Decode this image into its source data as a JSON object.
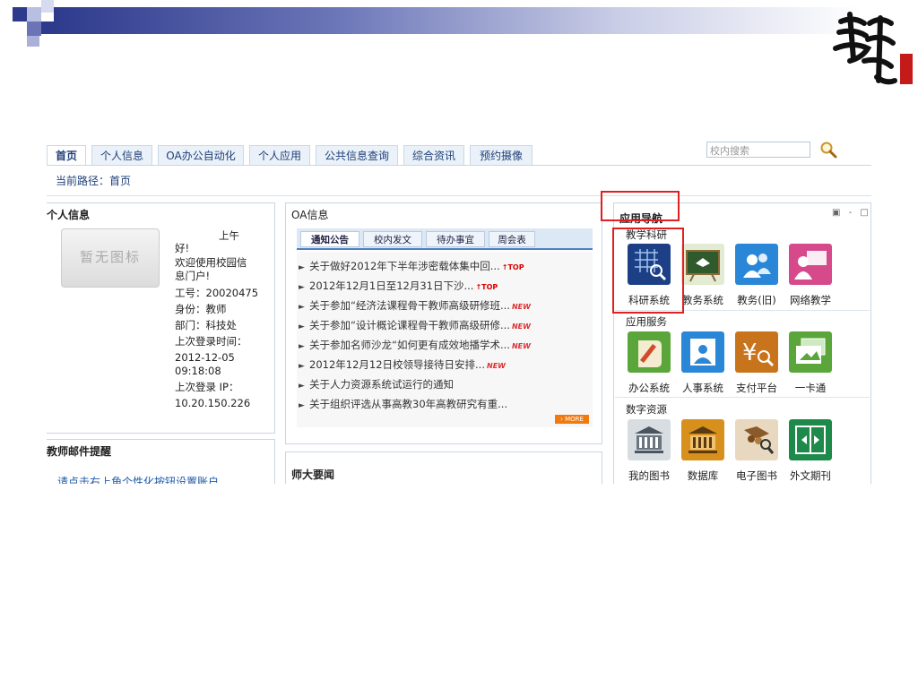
{
  "nav": {
    "tabs": [
      "首页",
      "个人信息",
      "OA办公自动化",
      "个人应用",
      "公共信息查询",
      "综合资讯",
      "预约摄像"
    ],
    "search_placeholder": "校内搜索"
  },
  "breadcrumb": "当前路径：首页",
  "personal": {
    "title": "个人信息",
    "avatar_text": "暂无图标",
    "lines": [
      "上午",
      "好!",
      "欢迎使用校园信",
      "息门户!",
      "工号：20020475",
      "身份：教师",
      "部门：科技处",
      "上次登录时间：",
      "2012-12-05",
      "09:18:08",
      "上次登录 IP：",
      "10.20.150.226"
    ]
  },
  "mail": {
    "title": "教师邮件提醒",
    "link": "请点击右上角个性化按钮设置账户"
  },
  "oa": {
    "title": "OA信息",
    "tabs": [
      "通知公告",
      "校内发文",
      "待办事宜",
      "周会表"
    ],
    "items": [
      {
        "text": "关于做好2012年下半年涉密载体集中回...",
        "badge": "TOP"
      },
      {
        "text": "2012年12月1日至12月31日下沙...",
        "badge": "TOP"
      },
      {
        "text": "关于参加“经济法课程骨干教师高级研修班...",
        "badge": "NEW"
      },
      {
        "text": "关于参加“设计概论课程骨干教师高级研修...",
        "badge": "NEW"
      },
      {
        "text": "关于参加名师沙龙“如何更有成效地播学术...",
        "badge": "NEW"
      },
      {
        "text": "2012年12月12日校领导接待日安排...",
        "badge": "NEW"
      },
      {
        "text": "关于人力资源系统试运行的通知",
        "badge": ""
      },
      {
        "text": "关于组织评选从事高教30年高教研究有重...",
        "badge": ""
      }
    ],
    "more": "› MORE"
  },
  "news": {
    "title": "师大要闻"
  },
  "appnav": {
    "title": "应用导航",
    "sections": [
      {
        "title": "教学科研",
        "apps": [
          {
            "label": "科研系统",
            "icon": "grid-magnifier-icon"
          },
          {
            "label": "教务系统",
            "icon": "blackboard-icon"
          },
          {
            "label": "教务(旧)",
            "icon": "users-icon"
          },
          {
            "label": "网络教学",
            "icon": "teacher-icon"
          }
        ]
      },
      {
        "title": "应用服务",
        "apps": [
          {
            "label": "办公系统",
            "icon": "scroll-icon"
          },
          {
            "label": "人事系统",
            "icon": "person-card-icon"
          },
          {
            "label": "支付平台",
            "icon": "yen-search-icon"
          },
          {
            "label": "一卡通",
            "icon": "cards-icon"
          }
        ]
      },
      {
        "title": "数字资源",
        "apps": [
          {
            "label": "我的图书",
            "icon": "library-icon"
          },
          {
            "label": "数据库",
            "icon": "building-icon"
          },
          {
            "label": "电子图书",
            "icon": "ebook-icon"
          },
          {
            "label": "外文期刊",
            "icon": "journal-icon"
          }
        ]
      }
    ]
  },
  "colors": {
    "accent": "#1f3f78",
    "highlight": "#e02020",
    "header_dark": "#2e3a8c"
  }
}
